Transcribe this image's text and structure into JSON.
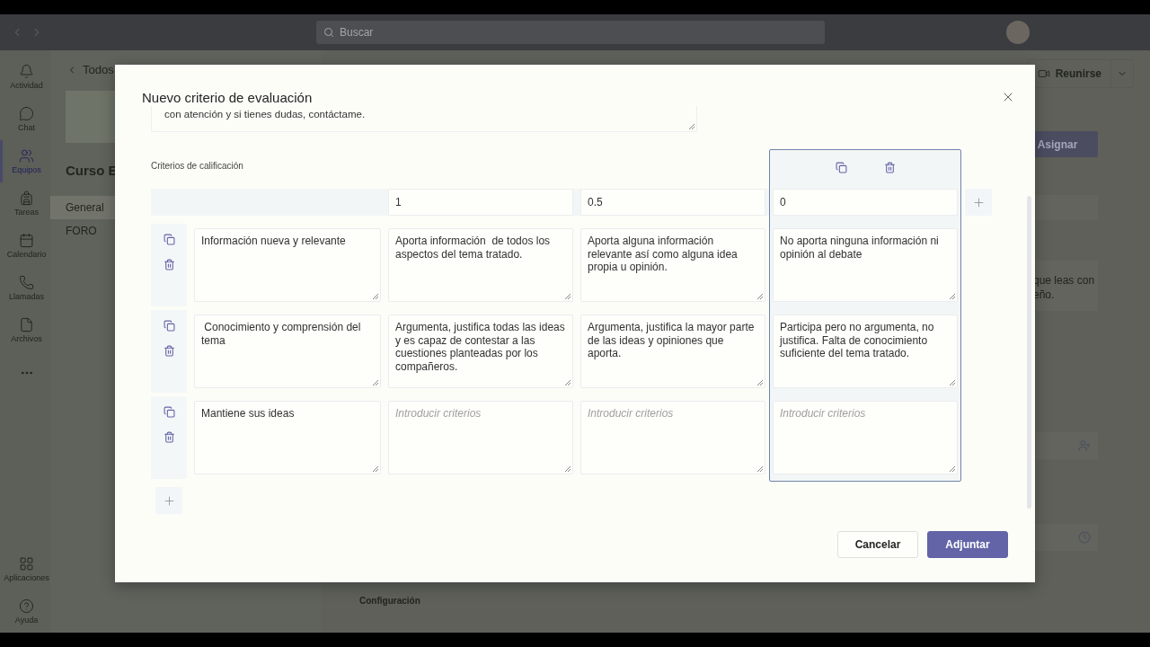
{
  "titlebar": {
    "search": {
      "placeholder": "Buscar"
    }
  },
  "rail": {
    "items": [
      {
        "label": "Actividad",
        "selected": false
      },
      {
        "label": "Chat",
        "selected": false
      },
      {
        "label": "Equipos",
        "selected": true
      },
      {
        "label": "Tareas",
        "selected": false
      },
      {
        "label": "Calendario",
        "selected": false
      },
      {
        "label": "Llamadas",
        "selected": false
      },
      {
        "label": "Archivos",
        "selected": false
      }
    ],
    "bottom_items": [
      {
        "label": "Aplicaciones"
      },
      {
        "label": "Ayuda"
      }
    ]
  },
  "team_panel": {
    "back_label": "Todos",
    "team_name": "Curso E",
    "channels": [
      {
        "label": "General",
        "selected": true
      },
      {
        "label": "FORO",
        "selected": false
      }
    ]
  },
  "main": {
    "meet_button": "Reunirse",
    "assign_button": "Asignar",
    "instructions_lines": [
      "que leas con",
      "eño."
    ],
    "section_label": "Configuración"
  },
  "dialog": {
    "title": "Nuevo criterio de evaluación",
    "description": "con atención y si tienes dudas, contáctame.",
    "section_label": "Criterios de calificación",
    "levels": [
      {
        "points": "1",
        "selected": false
      },
      {
        "points": "0.5",
        "selected": false
      },
      {
        "points": "0",
        "selected": true
      }
    ],
    "criteria": [
      {
        "name": "Información nueva y relevante",
        "descriptions": [
          {
            "value": "Aporta información  de todos los aspectos del tema tratado."
          },
          {
            "value": "Aporta alguna información relevante así como alguna idea propia u opinión."
          },
          {
            "value": "No aporta ninguna información ni opinión al debate"
          }
        ]
      },
      {
        "name": " Conocimiento y comprensión del tema",
        "descriptions": [
          {
            "value": "Argumenta, justifica todas las ideas y es capaz de contestar a las cuestiones planteadas por los compañeros."
          },
          {
            "value": "Argumenta, justifica la mayor parte de las ideas y opiniones que aporta."
          },
          {
            "value": "Participa pero no argumenta, no justifica. Falta de conocimiento suficiente del tema tratado."
          }
        ]
      },
      {
        "name": "Mantiene sus ideas",
        "descriptions": [
          {
            "placeholder": "Introducir criterios"
          },
          {
            "placeholder": "Introducir criterios"
          },
          {
            "placeholder": "Introducir criterios"
          }
        ]
      }
    ],
    "buttons": {
      "cancel": "Cancelar",
      "submit": "Adjuntar"
    }
  }
}
